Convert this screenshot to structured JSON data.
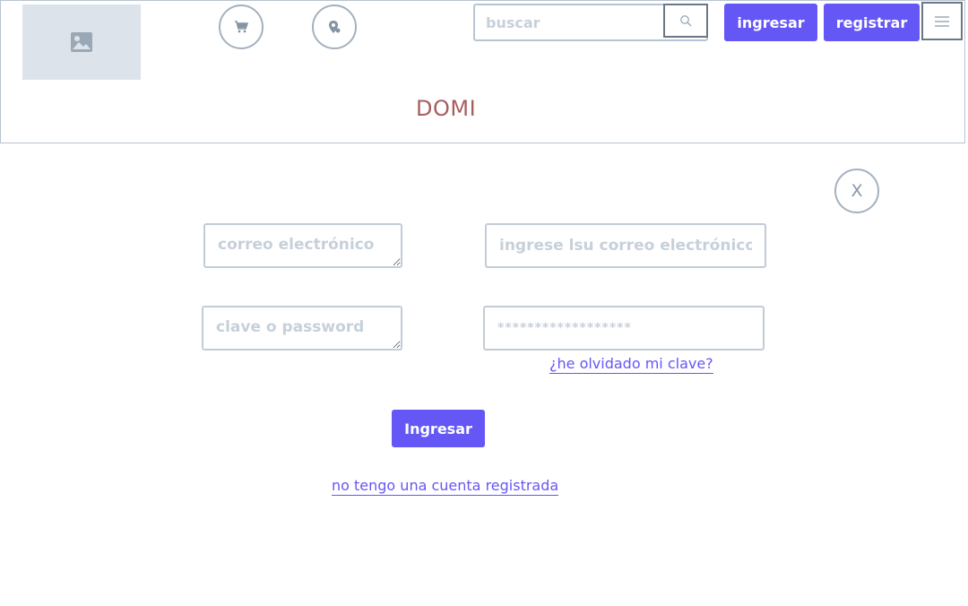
{
  "header": {
    "brand": "DOMI",
    "search": {
      "placeholder": "buscar"
    },
    "login_label": "ingresar",
    "register_label": "registrar"
  },
  "icons": {
    "logo": "image-placeholder-icon",
    "cart": "cart-icon",
    "place": "map-pin-icon",
    "search": "search-icon",
    "menu": "hamburger-menu-icon"
  },
  "login_form": {
    "close_label": "X",
    "email_label_placeholder": "correo electrónico",
    "email_input_placeholder": "ingrese lsu correo electrónico",
    "password_label_placeholder": "clave o password",
    "password_value": "******************",
    "forgot_link": "¿he olvidado mi clave?",
    "submit_label": "Ingresar",
    "no_account_link": "no tengo una cuenta registrada"
  },
  "colors": {
    "accent": "#6557f5",
    "brand_text": "#a85d5f",
    "border": "#b8c4d1",
    "placeholder_text": "#c7d0da"
  }
}
